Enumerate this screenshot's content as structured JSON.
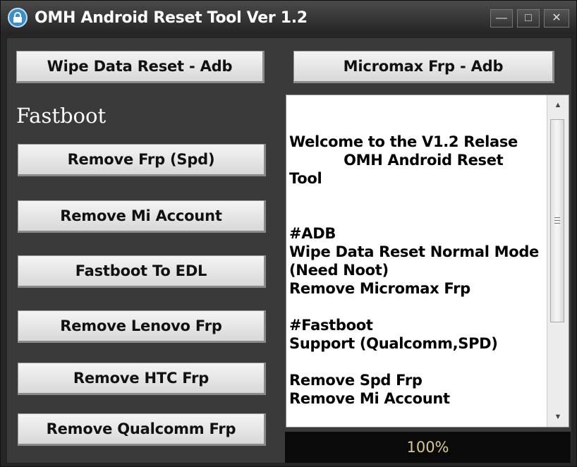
{
  "window": {
    "title": "OMH Android Reset Tool Ver 1.2",
    "controls": {
      "minimize": "—",
      "maximize": "□",
      "close": "✕"
    }
  },
  "adb_buttons": {
    "wipe_data": "Wipe Data Reset - Adb",
    "micromax_frp": "Micromax Frp - Adb"
  },
  "fastboot": {
    "section_title": "Fastboot",
    "buttons": [
      "Remove Frp (Spd)",
      "Remove Mi Account",
      "Fastboot To EDL",
      "Remove Lenovo Frp",
      "Remove HTC Frp",
      "Remove Qualcomm Frp"
    ]
  },
  "log": {
    "lines": [
      "Welcome to the V1.2 Relase",
      "           OMH Android Reset",
      "Tool",
      "",
      "",
      "#ADB",
      "Wipe Data Reset Normal Mode",
      "(Need Noot)",
      "Remove Micromax Frp",
      "",
      "#Fastboot",
      "Support (Qualcomm,SPD)",
      "",
      "Remove Spd Frp",
      "Remove Mi Account"
    ]
  },
  "scrollbar": {
    "up_icon": "▲",
    "down_icon": "▼"
  },
  "progress": {
    "label": "100%",
    "value": 1.0
  },
  "icons": [
    "lock-icon"
  ],
  "colors": {
    "progress_text": "#d7c98b",
    "app_icon": "#3a8fc7"
  }
}
